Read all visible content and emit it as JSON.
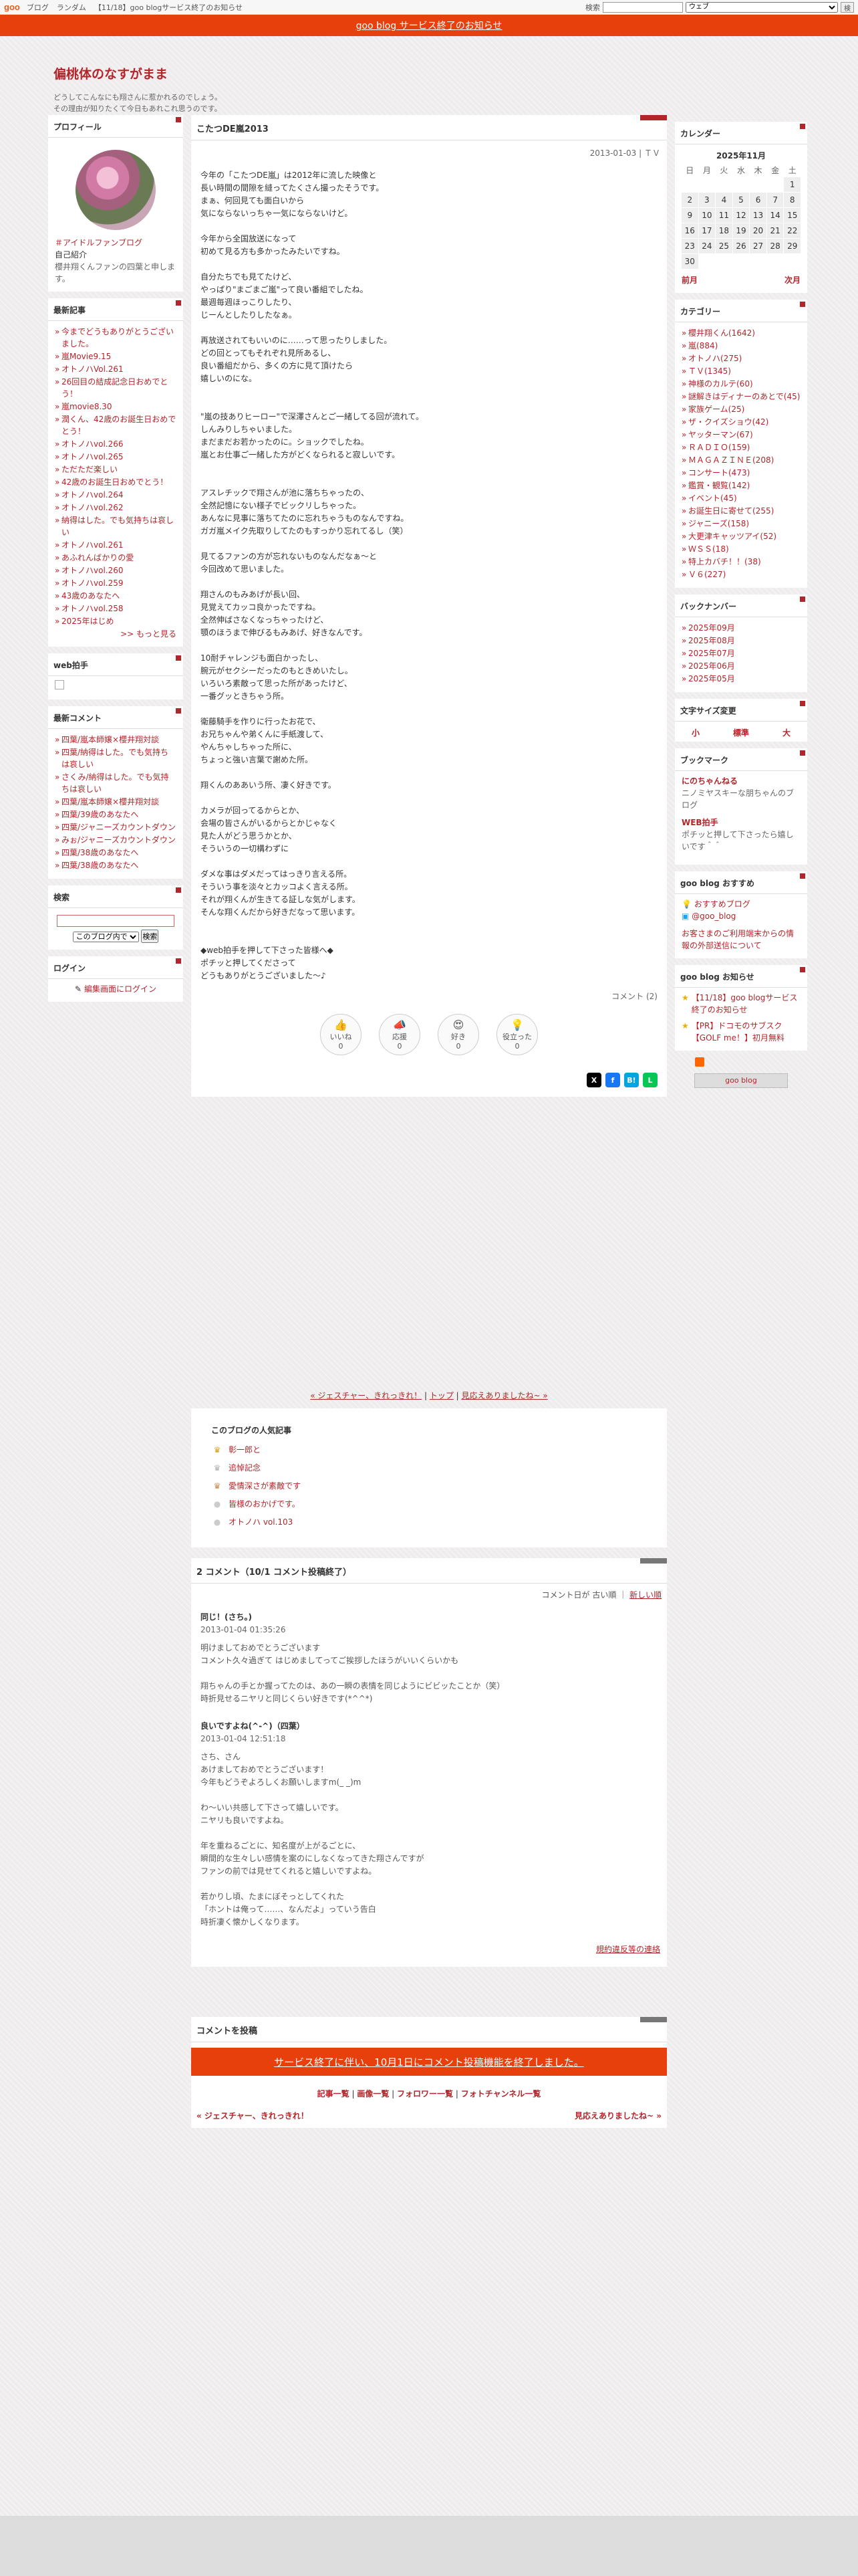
{
  "topbar": {
    "logo": "goo",
    "links": [
      "ブログ",
      "ランダム",
      "【11/18】goo blogサービス終了のお知らせ"
    ],
    "search_label": "検索",
    "search_select": "ウェブ",
    "search_button": "検"
  },
  "notice": "goo blog サービス終了のお知らせ",
  "header": {
    "title": "偏桃体のなすがまま",
    "desc1": "どうしてこんなにも翔さんに惹かれるのでしょう。",
    "desc2": "その理由が知りたくて今日もあれこれ思うのです。"
  },
  "left": {
    "profile": {
      "title": "プロフィール",
      "fan_link": "＃アイドルファンブログ",
      "intro_label": "自己紹介",
      "intro_text": "櫻井翔くんファンの四葉と申します。"
    },
    "recent": {
      "title": "最新記事",
      "items": [
        "今までどうもありがとうございました。",
        "嵐Movie9.15",
        "オトノハVol.261",
        "26回目の結成記念日おめでとう！",
        "嵐movie8.30",
        "潤くん、42歳のお誕生日おめでとう！",
        "オトノハvol.266",
        "オトノハvol.265",
        "ただただ楽しい",
        "42歳のお誕生日おめでとう！",
        "オトノハvol.264",
        "オトノハvol.262",
        "納得はした。でも気持ちは哀しい",
        "オトノハvol.261",
        "あふれんばかりの愛",
        "オトノハvol.260",
        "オトノハvol.259",
        "43歳のあなたへ",
        "オトノハvol.258",
        "2025年はじめ"
      ],
      "more": ">> もっと見る"
    },
    "webclap": {
      "title": "web拍手"
    },
    "recent_comments": {
      "title": "最新コメント",
      "items": [
        "四葉/嵐本師嬢×櫻井翔対談",
        "四葉/納得はした。でも気持ちは哀しい",
        "さくみ/納得はした。でも気持ちは哀しい",
        "四葉/嵐本師嬢×櫻井翔対談",
        "四葉/39歳のあなたへ",
        "四葉/ジャニーズカウントダウン",
        "みぉ/ジャニーズカウントダウン",
        "四葉/38歳のあなたへ",
        "四葉/38歳のあなたへ"
      ]
    },
    "search": {
      "title": "検索",
      "scope": "このブログ内で",
      "button": "検索"
    },
    "login": {
      "title": "ログイン",
      "link": "編集画面にログイン"
    }
  },
  "entry": {
    "title": "こたつDE嵐2013",
    "date": "2013-01-03",
    "category": "ＴＶ",
    "body": "今年の「こたつDE嵐」は2012年に流した映像と\n長い時間の間隙を縫ってたくさん撮ったそうです。\nまぁ、何回見ても面白いから\n気にならないっちゃ一気にならないけど。\n\n今年から全国放送になって\n初めて見る方も多かったみたいですね。\n\n自分たちでも見てたけど、\nやっぱり\"まごまご嵐\"って良い番組でしたね。\n最週毎週ほっこりしたり、\nじーんとしたりしたなぁ。\n\n再放送されてもいいのに……って思ったりしました。\nどの回とってもそれぞれ見所あるし、\n良い番組だから、多くの方に見て頂けたら\n嬉しいのにな。\n\n\n\"嵐の技ありヒーロー\"で深澤さんとご一緒してる回が流れて。\nしんみりしちゃいました。\nまだまだお若かったのに。ショックでしたね。\n嵐とお仕事ご一緒した方がどくなられると寂しいです。\n\n\nアスレチックで翔さんが池に落ちちゃったの、\n全然記憶にない様子でビックリしちゃった。\nあんなに見事に落ちてたのに忘れちゃうものなんですね。\nガガ嵐メイク先取りしてたのもすっかり忘れてるし（笑）\n\n見てるファンの方が忘れないものなんだなぁ～と\n今回改めて思いました。\n\n翔さんのもみあげが長い回、\n見覚えてカッコ良かったですね。\n全然伸ばさなくなっちゃったけど、\n顎のほうまで伸びるもみあげ、好きなんです。\n\n10耐チャレンジも面白かったし、\n腕元がセクシーだったのもときめいたし。\nいろいろ素敵って思った所があったけど、\n一番グッときちゃう所。\n\n衛藤騎手を作りに行ったお花で、\nお兄ちゃんや弟くんに手紙渡して、\nやんちゃしちゃった所に、\nちょっと強い言葉で謝めた所。\n\n翔くんのああいう所、凄く好きです。\n\nカメラが回ってるからとか、\n会場の皆さんがいるからとかじゃなく\n見た人がどう思うかとか、\nそういうの一切構わずに\n\nダメな事はダメだってはっきり言える所。\nそういう事を淡々とカッコよく言える所。\nそれが翔くんが生きてる証しな気がします。\nそんな翔くんだから好きだなって思います。\n\n\n◆web拍手を押して下さった皆様へ◆\nポチッと押してくださって\nどうもありがとうございました～♪",
    "comment_link": "コメント (2)",
    "reactions": [
      {
        "label": "いいね",
        "icon": "👍",
        "count": "0"
      },
      {
        "label": "応援",
        "icon": "📣",
        "count": "0"
      },
      {
        "label": "好き",
        "icon": "😍",
        "count": "0"
      },
      {
        "label": "役立った",
        "icon": "💡",
        "count": "0"
      }
    ],
    "share": [
      "X",
      "f",
      "B!",
      "L"
    ]
  },
  "nav": {
    "prev": "« ジェスチャー、きれっきれ！",
    "top": "トップ",
    "next": "見応えありましたね~ »"
  },
  "popular": {
    "title": "このブログの人気記事",
    "items": [
      "彰一郎と",
      "追悼記念",
      "愛情深さが素敵です",
      "皆様のおかげです。",
      "オトノハ vol.103"
    ]
  },
  "comments": {
    "title": "2 コメント（10/1 コメント投稿終了）",
    "sort_label": "コメント日が",
    "sort_old": "古い順",
    "sort_new": "新しい順",
    "items": [
      {
        "title": "同じ！(さち。)",
        "date": "2013-01-04 01:35:26",
        "body": "明けましておめでとうございます\nコメント久々過ぎて はじめましてってご挨拶したほうがいいくらいかも\n\n翔ちゃんの手とか握ってたのは、あの一瞬の表情を同じようにビビッたことか（笑）\n時折見せるニヤリと同じくらい好きです(*^^*)"
      },
      {
        "title": "良いですよね(^-^)（四葉）",
        "date": "2013-01-04 12:51:18",
        "body": "さち、さん\nあけましておめでとうございます！\n今年もどうぞよろしくお願いしますm(_ _)m\n\nわ～いい共感して下さって嬉しいです。\nニヤリも良いですよね。\n\n年を重ねるごとに、知名度が上がるごとに、\n瞬間的な生々しい感情を案のにしなくなってきた翔さんですが\nファンの前では見せてくれると嬉しいですよね。\n\n若かりし頃、たまにぼそっとしてくれた\n「ホントは俺って……、なんだよ」っていう告白\n時折凄く懐かしくなります。"
      }
    ],
    "report": "規約違反等の連絡"
  },
  "post_comment": {
    "title": "コメントを投稿",
    "end_notice": "サービス終了に伴い、10月1日にコメント投稿機能を終了しました。",
    "links": [
      "記事一覧",
      "画像一覧",
      "フォロワー一覧",
      "フォトチャンネル一覧"
    ],
    "prev": "« ジェスチャー、きれっきれ！",
    "next": "見応えありましたね~ »"
  },
  "right": {
    "calendar": {
      "title": "カレンダー",
      "month": "2025年11月",
      "dows": [
        "日",
        "月",
        "火",
        "水",
        "木",
        "金",
        "土"
      ],
      "days": [
        "",
        "",
        "",
        "",
        "",
        "",
        "1",
        "2",
        "3",
        "4",
        "5",
        "6",
        "7",
        "8",
        "9",
        "10",
        "11",
        "12",
        "13",
        "14",
        "15",
        "16",
        "17",
        "18",
        "19",
        "20",
        "21",
        "22",
        "23",
        "24",
        "25",
        "26",
        "27",
        "28",
        "29",
        "30",
        "",
        "",
        "",
        "",
        "",
        ""
      ],
      "prev": "前月",
      "next": "次月"
    },
    "categories": {
      "title": "カテゴリー",
      "items": [
        "櫻井翔くん(1642)",
        "嵐(884)",
        "オトノハ(275)",
        "ＴＶ(1345)",
        "神様のカルテ(60)",
        "謎解きはディナーのあとで(45)",
        "家族ゲーム(25)",
        "ザ・クイズショウ(42)",
        "ヤッターマン(67)",
        "ＲＡＤＩＯ(159)",
        "ＭＡＧＡＺＩＮＥ(208)",
        "コンサート(473)",
        "鑑賞・観覧(142)",
        "イベント(45)",
        "お誕生日に寄せて(255)",
        "ジャニーズ(158)",
        "大更津キャッツアイ(52)",
        "ＷＳＳ(18)",
        "特上カバチ！！(38)",
        "Ｖ６(227)"
      ]
    },
    "backnumber": {
      "title": "バックナンバー",
      "items": [
        "2025年09月",
        "2025年08月",
        "2025年07月",
        "2025年06月",
        "2025年05月"
      ]
    },
    "fontsize": {
      "title": "文字サイズ変更",
      "small": "小",
      "mid": "標準",
      "large": "大"
    },
    "bookmark": {
      "title": "ブックマーク",
      "items": [
        {
          "name": "にのちゃんねる",
          "desc": "ニノミヤスキーな朋ちゃんのブログ"
        },
        {
          "name": "WEB拍手",
          "desc": "ポチッと押して下さったら嬉しいです＾＾"
        }
      ]
    },
    "recommend": {
      "title": "goo blog おすすめ",
      "items": [
        "おすすめブログ",
        "@goo_blog"
      ],
      "note": "お客さまのご利用端末からの情報の外部送信について"
    },
    "news": {
      "title": "goo blog お知らせ",
      "items": [
        "【11/18】goo blogサービス終了のお知らせ",
        "【PR】ドコモのサブスク【GOLF me！】初月無料"
      ]
    },
    "gooblog_btn": "goo blog"
  }
}
